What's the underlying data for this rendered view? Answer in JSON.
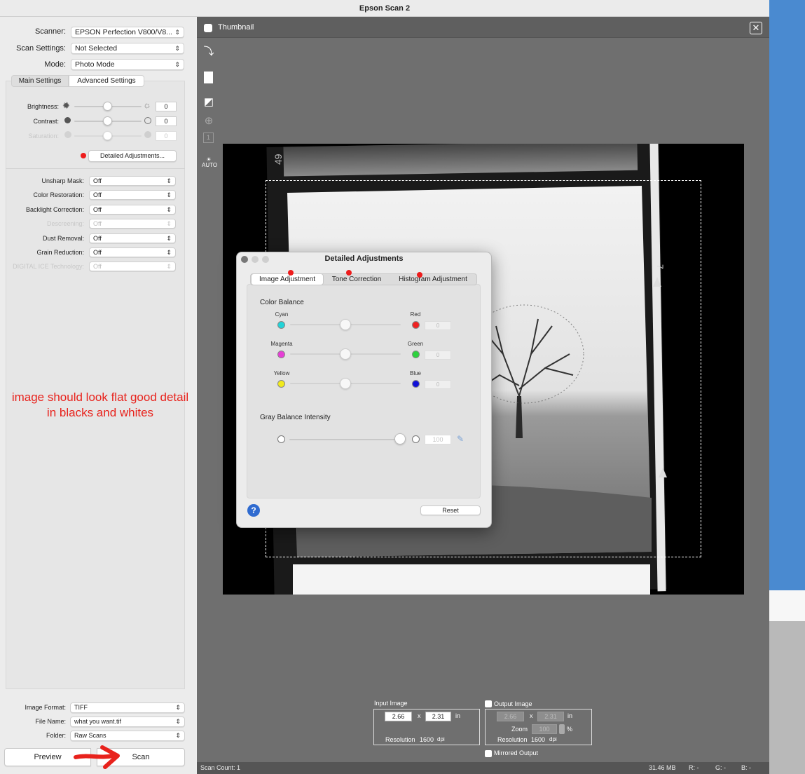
{
  "window": {
    "title": "Epson Scan 2"
  },
  "left_panel": {
    "scanner": {
      "label": "Scanner:",
      "value": "EPSON Perfection V800/V8..."
    },
    "scan_settings": {
      "label": "Scan Settings:",
      "value": "Not Selected"
    },
    "mode": {
      "label": "Mode:",
      "value": "Photo Mode"
    },
    "tabs": {
      "main": "Main Settings",
      "advanced": "Advanced Settings"
    },
    "brightness": {
      "label": "Brightness:",
      "value": "0",
      "fraction": 0.5
    },
    "contrast": {
      "label": "Contrast:",
      "value": "0",
      "fraction": 0.5
    },
    "saturation": {
      "label": "Saturation:",
      "value": "0",
      "fraction": 0.5
    },
    "detailed_button": "Detailed Adjustments...",
    "options": [
      {
        "label": "Unsharp Mask:",
        "value": "Off",
        "disabled": false
      },
      {
        "label": "Color Restoration:",
        "value": "Off",
        "disabled": false
      },
      {
        "label": "Backlight Correction:",
        "value": "Off",
        "disabled": false
      },
      {
        "label": "Descreening:",
        "value": "Off",
        "disabled": true
      },
      {
        "label": "Dust Removal:",
        "value": "Off",
        "disabled": false
      },
      {
        "label": "Grain Reduction:",
        "value": "Off",
        "disabled": false
      },
      {
        "label": "DIGITAL ICE Technology:",
        "value": "Off",
        "disabled": true
      }
    ],
    "annotation": {
      "line1": "image should look flat good detail",
      "line2": "in blacks and whites",
      "color": "#e8221c"
    },
    "image_format": {
      "label": "Image Format:",
      "value": "TIFF"
    },
    "file_name": {
      "label": "File Name:",
      "value": "what you want.tif"
    },
    "folder": {
      "label": "Folder:",
      "value": "Raw Scans"
    },
    "preview_button": "Preview",
    "scan_button": "Scan"
  },
  "preview": {
    "thumbnail_label": "Thumbnail",
    "frame_number_top": "49",
    "frame_mark_right": "7",
    "status": {
      "scan_count": "Scan Count: 1",
      "size": "31.46 MB",
      "r": "R:  -",
      "g": "G:  -",
      "b": "B:  -"
    },
    "input_image": {
      "label": "Input Image",
      "width": "2.66",
      "x": "x",
      "height": "2.31",
      "unit": "in",
      "resolution_label": "Resolution",
      "resolution": "1600",
      "dpi": "dpi"
    },
    "output_image": {
      "label": "Output Image",
      "width": "2.66",
      "x": "x",
      "height": "2.31",
      "unit": "in",
      "zoom_label": "Zoom",
      "zoom": "100",
      "percent": "%",
      "resolution_label": "Resolution",
      "resolution": "1600",
      "dpi": "dpi"
    },
    "mirrored_label": "Mirrored Output"
  },
  "dialog": {
    "title": "Detailed Adjustments",
    "tabs": [
      "Image Adjustment",
      "Tone Correction",
      "Histogram Adjustment"
    ],
    "color_balance": "Color Balance",
    "rows": [
      {
        "left": "Cyan",
        "right": "Red",
        "left_color": "#22d3d8",
        "right_color": "#ee2222",
        "value": "0",
        "fraction": 0.5
      },
      {
        "left": "Magenta",
        "right": "Green",
        "left_color": "#e63fd6",
        "right_color": "#2ed23e",
        "value": "0",
        "fraction": 0.5
      },
      {
        "left": "Yellow",
        "right": "Blue",
        "left_color": "#f1ea1c",
        "right_color": "#1212d8",
        "value": "0",
        "fraction": 0.5
      }
    ],
    "gray_balance": "Gray Balance Intensity",
    "gray_value": "100",
    "reset": "Reset",
    "help": "?"
  }
}
